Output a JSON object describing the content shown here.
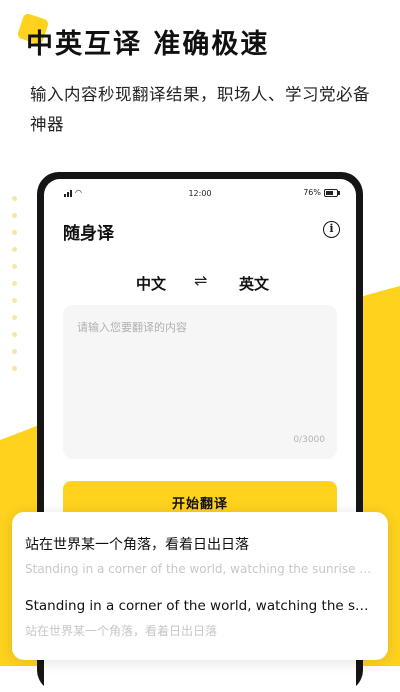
{
  "promo": {
    "headline": "中英互译  准确极速",
    "subtitle": "输入内容秒现翻译结果，职场人、学习党必备神器"
  },
  "status_bar": {
    "time": "12:00",
    "battery": "76%"
  },
  "app": {
    "title": "随身译",
    "source_language": "中文",
    "target_language": "英文",
    "swap_symbol": "⇌",
    "input_placeholder": "请输入您要翻译的内容",
    "char_count": "0/3000",
    "translate_button": "开始翻译"
  },
  "history": [
    {
      "primary": "站在世界某一个角落，看着日出日落",
      "secondary": "Standing in a corner of the world, watching the sunrise and sunset"
    },
    {
      "primary": "Standing in a corner of the world, watching the sunrise and sunset",
      "secondary": "站在世界某一个角落，看着日出日落"
    }
  ],
  "colors": {
    "accent": "#ffd21e",
    "background": "#ffffff",
    "phone_frame": "#151515"
  },
  "icons": [
    "signal-icon",
    "wifi-icon",
    "battery-icon",
    "info-icon",
    "swap-icon"
  ]
}
